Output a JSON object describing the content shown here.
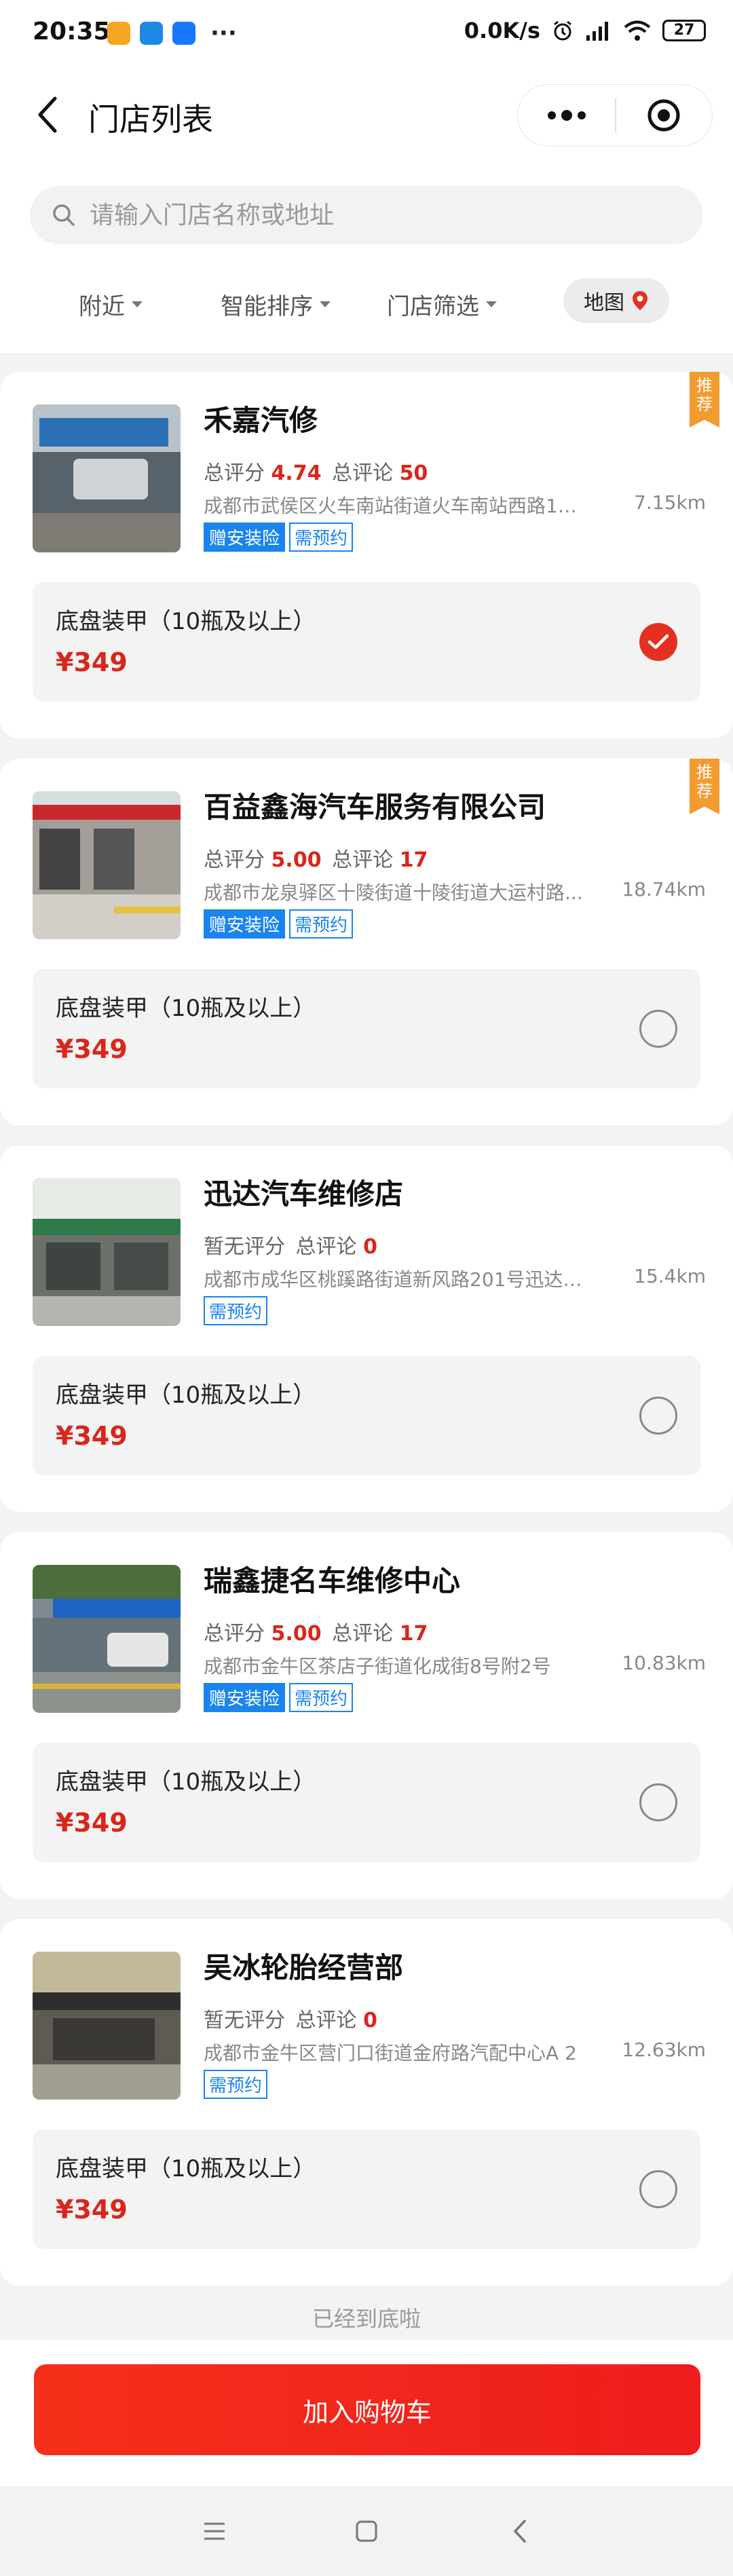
{
  "status_bar": {
    "time": "20:35",
    "dots": "···",
    "net_speed": "0.0K/s",
    "battery": "27",
    "app_colors": [
      "#f6a623",
      "#1e88e5",
      "#1677ff"
    ]
  },
  "header": {
    "title": "门店列表",
    "back_icon": "chevron-left-icon",
    "more_icon": "more-dots-icon",
    "close_icon": "target-close-icon"
  },
  "search": {
    "placeholder": "请输入门店名称或地址"
  },
  "filters": [
    {
      "label": "附近"
    },
    {
      "label": "智能排序"
    },
    {
      "label": "门店筛选"
    }
  ],
  "map_button": {
    "label": "地图"
  },
  "stores": [
    {
      "name": "禾嘉汽修",
      "score_label": "总评分",
      "score": "4.74",
      "reviews_label": "总评论",
      "reviews": "50",
      "address": "成都市武侯区火车南站街道火车南站西路17...",
      "distance": "7.15km",
      "tags": [
        "赠安装险",
        "需预约"
      ],
      "recommend": "推荐",
      "service": "底盘装甲（10瓶及以上）",
      "price": "¥349",
      "selected": true
    },
    {
      "name": "百益鑫海汽车服务有限公司",
      "score_label": "总评分",
      "score": "5.00",
      "reviews_label": "总评论",
      "reviews": "17",
      "address": "成都市龙泉驿区十陵街道十陵街道大运村路...",
      "distance": "18.74km",
      "tags": [
        "赠安装险",
        "需预约"
      ],
      "recommend": "推荐",
      "service": "底盘装甲（10瓶及以上）",
      "price": "¥349",
      "selected": false
    },
    {
      "name": "迅达汽车维修店",
      "score_label": "暂无评分",
      "score": "",
      "reviews_label": "总评论",
      "reviews": "0",
      "address": "成都市成华区桃蹊路街道新风路201号迅达汽...",
      "distance": "15.4km",
      "tags": [
        "需预约"
      ],
      "recommend": "",
      "service": "底盘装甲（10瓶及以上）",
      "price": "¥349",
      "selected": false
    },
    {
      "name": "瑞鑫捷名车维修中心",
      "score_label": "总评分",
      "score": "5.00",
      "reviews_label": "总评论",
      "reviews": "17",
      "address": "成都市金牛区茶店子街道化成街8号附2号",
      "distance": "10.83km",
      "tags": [
        "赠安装险",
        "需预约"
      ],
      "recommend": "",
      "service": "底盘装甲（10瓶及以上）",
      "price": "¥349",
      "selected": false
    },
    {
      "name": "吴冰轮胎经营部",
      "score_label": "暂无评分",
      "score": "",
      "reviews_label": "总评论",
      "reviews": "0",
      "address": "成都市金牛区营门口街道金府路汽配中心A 2",
      "distance": "12.63km",
      "tags": [
        "需预约"
      ],
      "recommend": "",
      "service": "底盘装甲（10瓶及以上）",
      "price": "¥349",
      "selected": false
    }
  ],
  "end_text": "已经到底啦",
  "cart_button": "加入购物车",
  "colors": {
    "accent": "#e5301f",
    "price": "#d9261c",
    "tag_blue": "#1a84ef",
    "recommend": "#f29b2e"
  }
}
